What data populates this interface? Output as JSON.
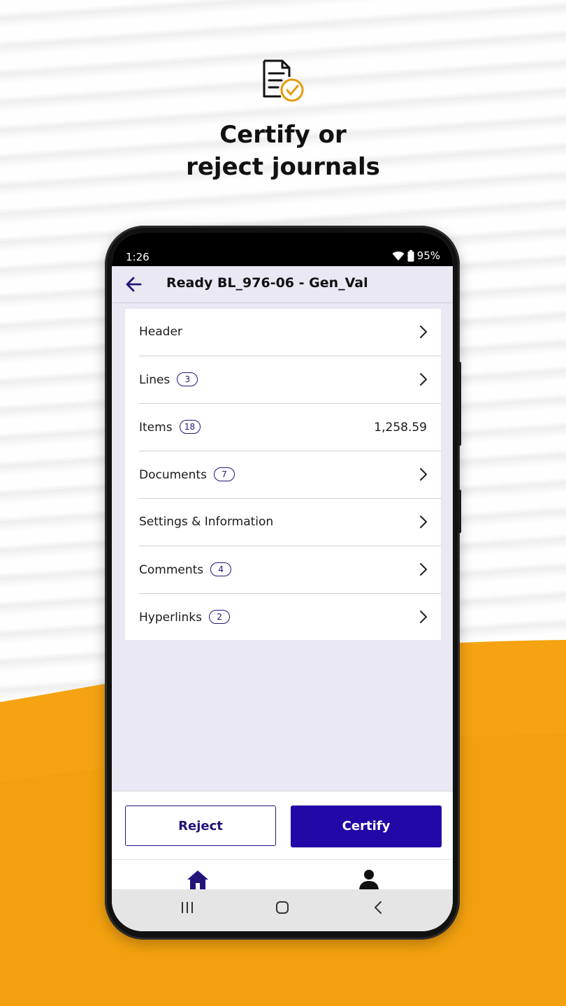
{
  "promo": {
    "headline_line1": "Certify or",
    "headline_line2": "reject journals",
    "icon": "document-check-icon",
    "accent_color": "#f4a10e"
  },
  "status_bar": {
    "time": "1:26",
    "battery": "95%",
    "icons": [
      "wifi-icon",
      "battery-icon"
    ]
  },
  "app_bar": {
    "title": "Ready BL_976-06 - Gen_Val",
    "back_icon": "arrow-left-icon"
  },
  "list": {
    "items": [
      {
        "label": "Header",
        "badge": null,
        "value": null,
        "chevron": true
      },
      {
        "label": "Lines",
        "badge": "3",
        "value": null,
        "chevron": true
      },
      {
        "label": "Items",
        "badge": "18",
        "value": "1,258.59",
        "chevron": false
      },
      {
        "label": "Documents",
        "badge": "7",
        "value": null,
        "chevron": true
      },
      {
        "label": "Settings & Information",
        "badge": null,
        "value": null,
        "chevron": true
      },
      {
        "label": "Comments",
        "badge": "4",
        "value": null,
        "chevron": true
      },
      {
        "label": "Hyperlinks",
        "badge": "2",
        "value": null,
        "chevron": true
      }
    ]
  },
  "actions": {
    "reject_label": "Reject",
    "certify_label": "Certify"
  },
  "bottom_nav": {
    "items": [
      "home-icon",
      "profile-icon"
    ]
  },
  "colors": {
    "primary": "#2208a6",
    "badge_border": "#22157a",
    "screen_bg": "#e9e8f3"
  }
}
